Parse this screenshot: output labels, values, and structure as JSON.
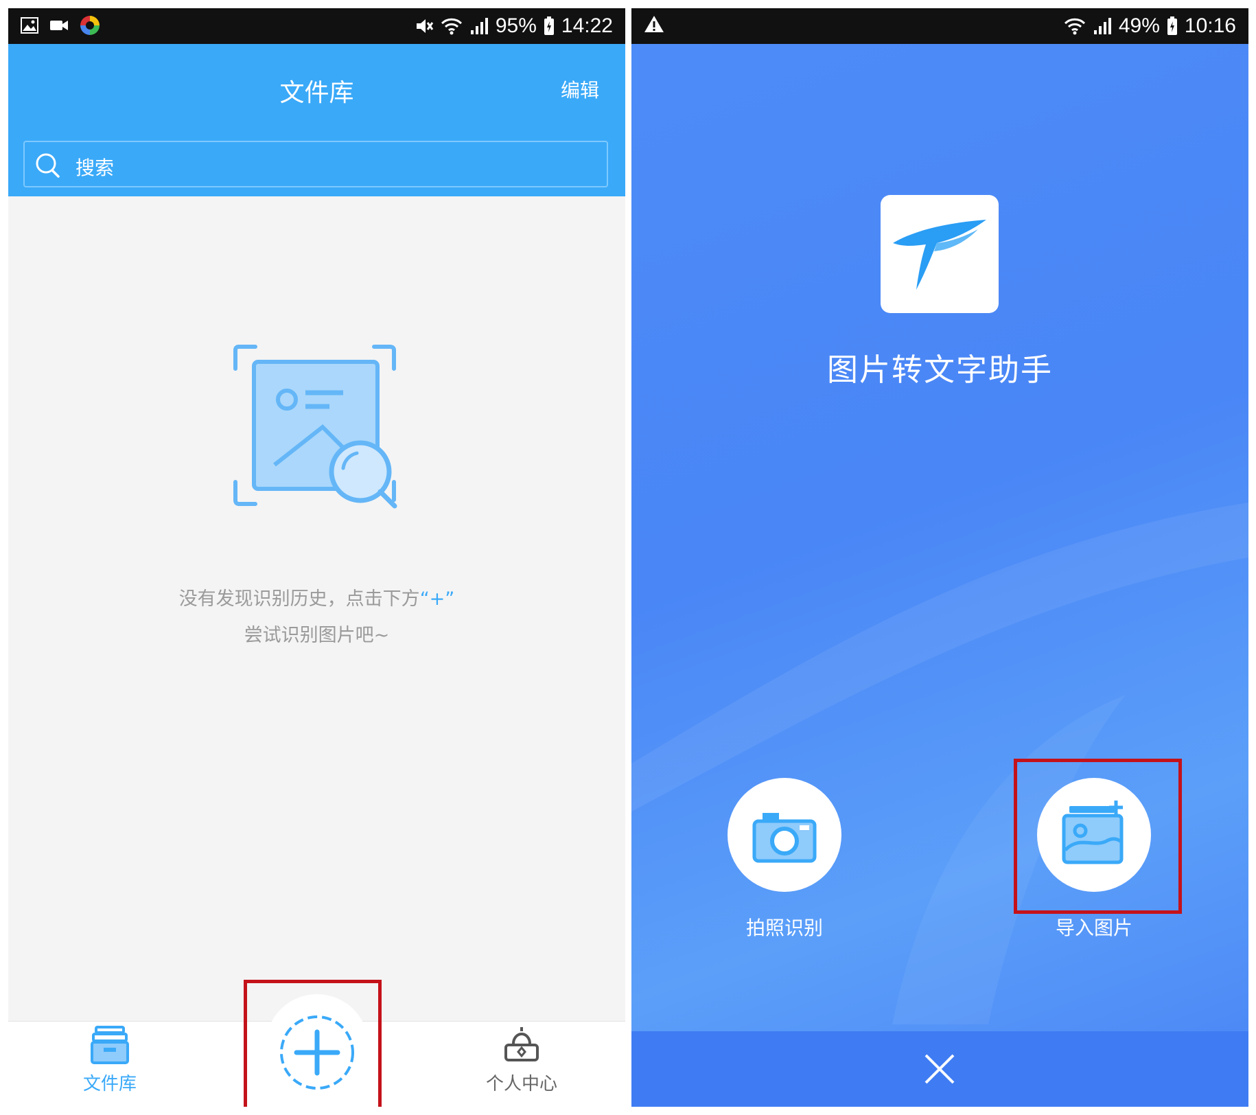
{
  "left": {
    "status": {
      "battery": "95%",
      "time": "14:22"
    },
    "appbar": {
      "title": "文件库",
      "edit": "编辑"
    },
    "search": {
      "placeholder": "搜索"
    },
    "empty": {
      "line1": "没有发现识别历史，点击下方",
      "plus": "“+”",
      "line2": "尝试识别图片吧~"
    },
    "nav": {
      "library": "文件库",
      "profile": "个人中心"
    },
    "colors": {
      "primary": "#3aa9f8",
      "highlight": "#c4121a"
    }
  },
  "right": {
    "status": {
      "battery": "49%",
      "time": "10:16"
    },
    "app_name": "图片转文字助手",
    "actions": {
      "camera": "拍照识别",
      "import": "导入图片"
    },
    "colors": {
      "background": "#4a86f6",
      "highlight": "#c4121a"
    }
  }
}
